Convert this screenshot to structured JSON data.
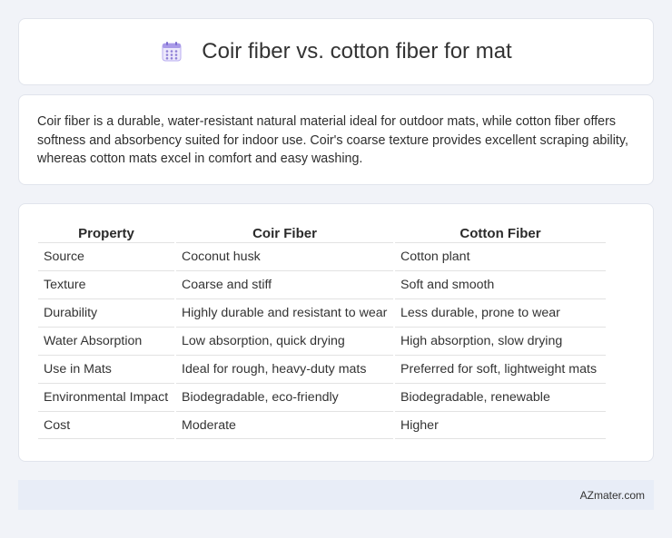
{
  "header": {
    "title": "Coir fiber vs. cotton fiber for mat",
    "icon": "calendar-grid-icon",
    "icon_color": "#8f7fd6"
  },
  "intro": {
    "text": "Coir fiber is a durable, water-resistant natural material ideal for outdoor mats, while cotton fiber offers softness and absorbency suited for indoor use. Coir's coarse texture provides excellent scraping ability, whereas cotton mats excel in comfort and easy washing."
  },
  "table": {
    "headers": [
      "Property",
      "Coir Fiber",
      "Cotton Fiber"
    ],
    "rows": [
      [
        "Source",
        "Coconut husk",
        "Cotton plant"
      ],
      [
        "Texture",
        "Coarse and stiff",
        "Soft and smooth"
      ],
      [
        "Durability",
        "Highly durable and resistant to wear",
        "Less durable, prone to wear"
      ],
      [
        "Water Absorption",
        "Low absorption, quick drying",
        "High absorption, slow drying"
      ],
      [
        "Use in Mats",
        "Ideal for rough, heavy-duty mats",
        "Preferred for soft, lightweight mats"
      ],
      [
        "Environmental Impact",
        "Biodegradable, eco-friendly",
        "Biodegradable, renewable"
      ],
      [
        "Cost",
        "Moderate",
        "Higher"
      ]
    ]
  },
  "footer": {
    "site": "AZmater.com"
  },
  "colors": {
    "page_background": "#f1f3f8",
    "footer_background": "#e8edf7"
  }
}
